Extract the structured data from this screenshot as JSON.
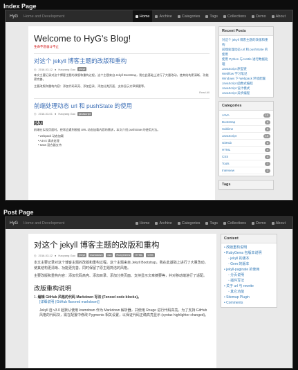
{
  "index_label": "Index Page",
  "post_label": "Post Page",
  "nav": {
    "brand": "HyG",
    "tagline": "Home and Development",
    "items": [
      {
        "label": "Home",
        "active": true
      },
      {
        "label": "Archive",
        "active": false
      },
      {
        "label": "Categories",
        "active": false
      },
      {
        "label": "Tags",
        "active": false
      },
      {
        "label": "Collections",
        "active": false
      },
      {
        "label": "Demo",
        "active": false
      },
      {
        "label": "About",
        "active": false
      }
    ]
  },
  "index": {
    "blog_title": "Welcome to HyG's Blog!",
    "blog_subtitle": "生命不息奋斗不止",
    "post1": {
      "title": "对这个 jekyll 博客主题的改版和重构",
      "date": "2016-03-12",
      "author": "Haoyang Gao",
      "category": "jekyll",
      "p1": "本文主要记录对这个博客主题的改版和重构过程。这个主题来自 Jekyll Bootstrap，我在此基础上进行了大量改动，使其结构更清晰、功能更完善。",
      "p2": "主要改版和重构内容：添加代码高亮、添加目录、添加分类页面、支持显示文章摘要等。",
      "readmore": "Read All"
    },
    "post2": {
      "title": "前端处理动态 url 和 pushState 的使用",
      "date": "2016-03-01",
      "author": "Haoyang Gao",
      "category": "javascript",
      "heading": "起因",
      "p1": "前端在实现页面时，经常会遇到根据 URL 动态加载内容的需求，本文介绍 pushState 的使用方法。",
      "items": [
        "webpack 动态加载",
        "AJAX 请求处理",
        "Sass 混合器支持"
      ]
    }
  },
  "index_side": {
    "recent_title": "Recent Posts",
    "recent": [
      "对这个 jekyll 博客主题的改版和重构",
      "前端处理动态 url 和 pushState 的使用",
      "使用 Python 与 Kettle 进行数据处理",
      "JavaScript 原型链",
      "Webflow 学习笔记",
      "Windows 下 Webpack 环境配置",
      "JavaScript 函数式编程",
      "JavaScript 设计模式",
      "JavaScript 异步编程"
    ],
    "categories_title": "Categories",
    "categories": [
      {
        "name": "JAVA",
        "count": "12"
      },
      {
        "name": "Bootstrap",
        "count": "8"
      },
      {
        "name": "Sublime",
        "count": "5"
      },
      {
        "name": "JavaScript",
        "count": "15"
      },
      {
        "name": "GitHub",
        "count": "6"
      },
      {
        "name": "HTML",
        "count": "4"
      },
      {
        "name": "CSS",
        "count": "3"
      },
      {
        "name": "Tools",
        "count": "7"
      },
      {
        "name": "Interview",
        "count": "2"
      }
    ],
    "tags_title": "Tags"
  },
  "post": {
    "title": "对这个 jekyll 博客主题的改版和重构",
    "date": "2016-03-12",
    "author": "Haoyang Gao",
    "tags": [
      "jekyll",
      "markdown",
      "css",
      "RubyGems",
      "HTML",
      "CSS"
    ],
    "p1": "本文主要记录对这个博客主题的改版和重构过程。这个主题来自 Jekyll Bootstrap，我在此基础上进行了大量改动，使其结构更清晰、功能更完善，同时保留了原主题简洁的风格。",
    "p2": "主要改版和重构内容：添加代码高亮、添加目录、添加分类页面、支持显示文章摘要等，并对移动端进行了适配。",
    "h2": "改版重构说明",
    "item1_title": "编辑 GitHub 风格的代码 Markdown 写法 (Fenced code blocks)。",
    "item1_sub": "[详细说明 (GitHub flavored markdown)]",
    "item1_text": "Jekyll 自 v3.0 起默认使用 kramdown 作为 Markdown 解析器，并使用 Rouge 进行代码高亮。为了支持 GitHub 风格的代码块，需在配置中修改 Pygments 相关设置，以保证代码正确高亮显示 (syntax highlighter changed)。"
  },
  "post_side": {
    "toc_title": "Content",
    "toc": [
      {
        "label": "改版重构说明",
        "sub": false
      },
      {
        "label": "RubyGems 包版本说明",
        "sub": false
      },
      {
        "label": "jekyll 的版本",
        "sub": true
      },
      {
        "label": "Gem 的版本",
        "sub": true
      },
      {
        "label": "jekyll-paginate 的使用",
        "sub": false
      },
      {
        "label": "分页说明",
        "sub": true
      },
      {
        "label": "插件写法",
        "sub": true
      },
      {
        "label": "关于 url 与 rewrite",
        "sub": false
      },
      {
        "label": "其它功能",
        "sub": true
      },
      {
        "label": "Sitemap Plugin",
        "sub": false
      },
      {
        "label": "Comments",
        "sub": false
      }
    ]
  }
}
